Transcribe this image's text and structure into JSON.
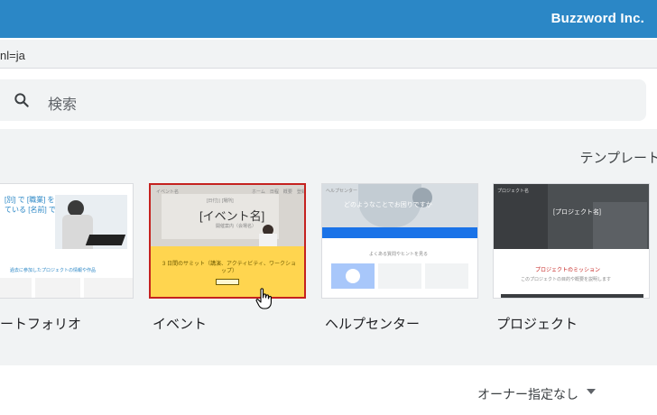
{
  "header": {
    "brand": "Buzzword Inc."
  },
  "urlbar": {
    "text": "nl=ja"
  },
  "search": {
    "placeholder": "検索"
  },
  "gallery": {
    "templates_link": "テンプレート",
    "items": [
      {
        "label": "ートフォリオ",
        "thumb_text": "[別] で [職業] をし<br>"
      },
      {
        "label": "イベント",
        "thumb_title": "[イベント名]",
        "thumb_subtitle": "3 日間のサミット（講演、アクティビティ、ワークショップ）"
      },
      {
        "label": "ヘルプセンター",
        "thumb_text": "どのようなことでお困りですか"
      },
      {
        "label": "プロジェクト",
        "thumb_title": "[プロジェクト名]",
        "thumb_subtitle": "プロジェクトのミッション"
      }
    ]
  },
  "filter": {
    "owner": "オーナー指定なし"
  },
  "colors": {
    "accent": "#2b87c6",
    "selection": "#c5221f",
    "event_yellow": "#ffd54f"
  }
}
